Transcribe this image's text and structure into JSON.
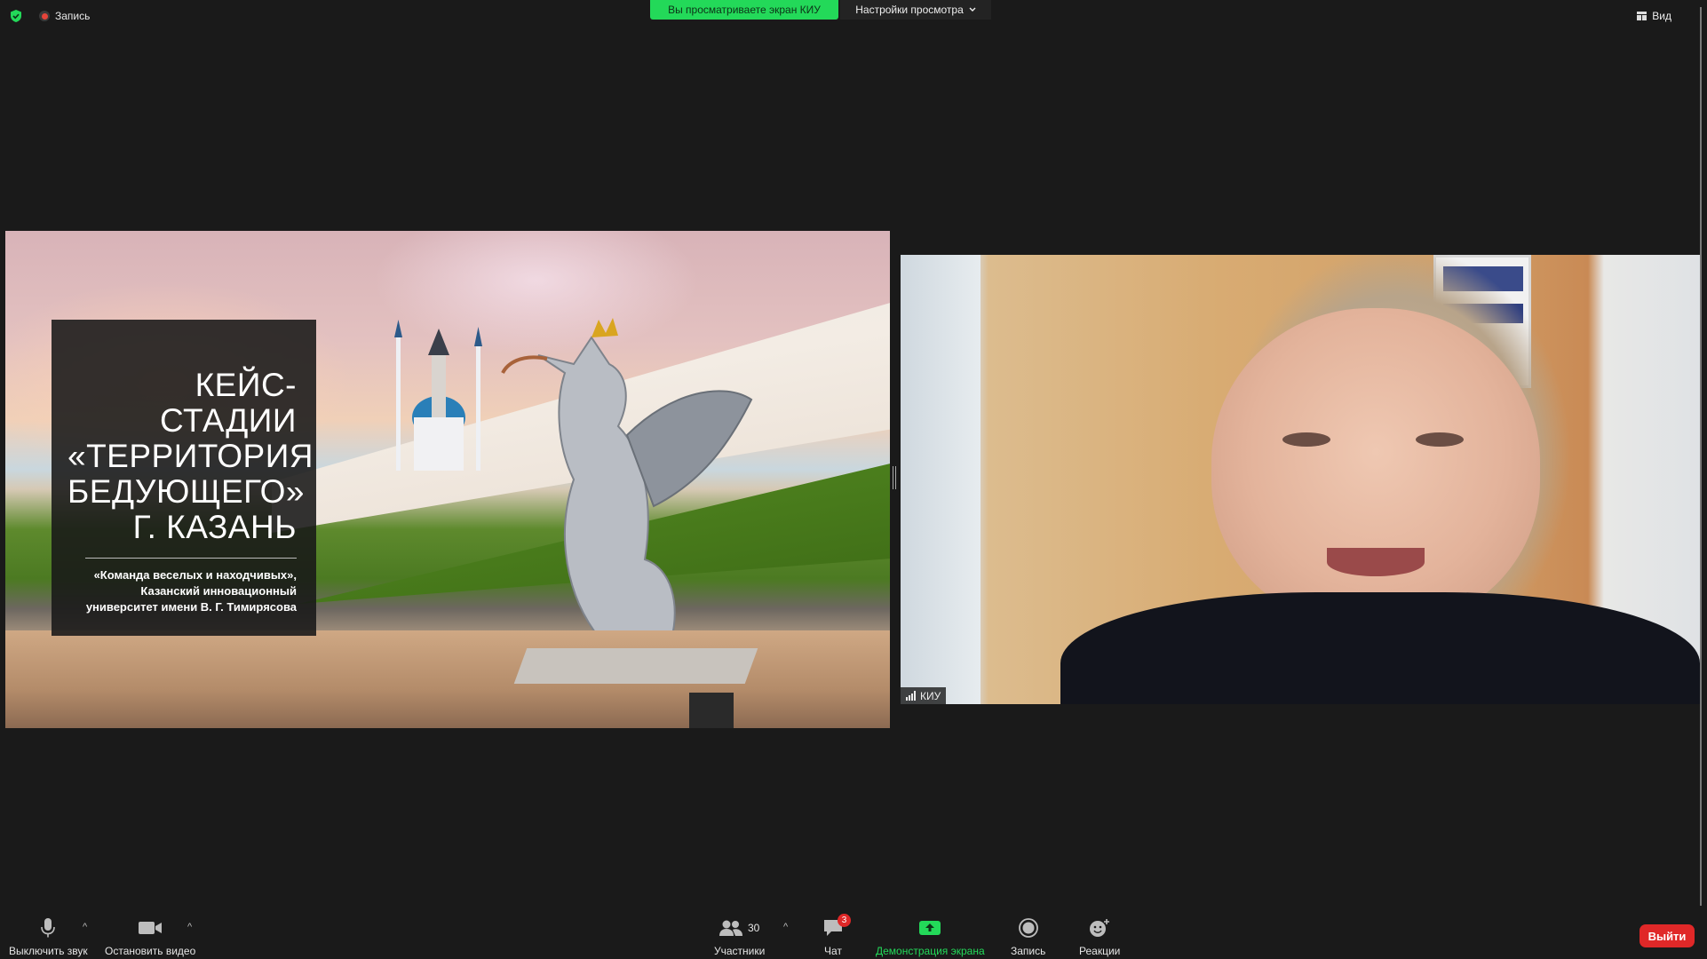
{
  "top_bar": {
    "recording_label": "Запись",
    "viewing_banner": "Вы просматриваете экран КИУ",
    "view_settings_label": "Настройки просмотра",
    "view_label": "Вид"
  },
  "slide": {
    "title_lines": [
      "КЕЙС-",
      "СТАДИИ",
      "«ТЕРРИТОРИЯ",
      "БЕДУЮЩЕГО»",
      "Г. КАЗАНЬ"
    ],
    "subtitle_lines": [
      "«Команда веселых и находчивых»,",
      "Казанский инновационный",
      "университет имени В. Г. Тимирясова"
    ]
  },
  "participant": {
    "name": "КИУ"
  },
  "toolbar": {
    "mute_label": "Выключить звук",
    "video_label": "Остановить видео",
    "participants_label": "Участники",
    "participants_count": "30",
    "chat_label": "Чат",
    "chat_badge": "3",
    "share_label": "Демонстрация экрана",
    "record_label": "Запись",
    "reactions_label": "Реакции",
    "leave_label": "Выйти"
  },
  "colors": {
    "accent_green": "#23d959",
    "leave_red": "#e02828",
    "background": "#1a1a1a"
  }
}
